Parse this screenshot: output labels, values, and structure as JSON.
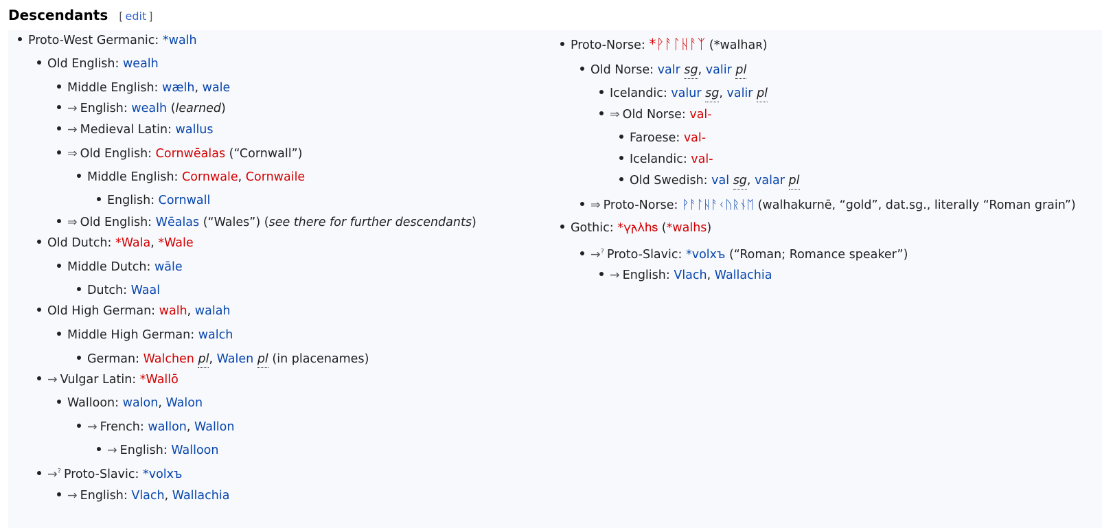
{
  "heading": {
    "title": "Descendants",
    "bracket_open": "[",
    "edit_label": "edit",
    "bracket_close": "]"
  },
  "colors": {
    "link": "#0645ad",
    "redlink": "#d20000",
    "box_background": "#f8f9fc",
    "text": "#202122"
  },
  "tree": {
    "pwg_lang": "Proto-West Germanic:",
    "pwg_w1": "*walh",
    "oe_lang": "Old English:",
    "oe_w1": "wealh",
    "me1_lang": "Middle English:",
    "me1_w1": "wælh",
    "me1_w2": "wale",
    "eng1_arrow": "→",
    "eng1_lang": "English:",
    "eng1_w1": "wealh",
    "eng1_note_open": "(",
    "eng1_note": "learned",
    "eng1_note_close": ")",
    "ml_arrow": "→",
    "ml_lang": "Medieval Latin:",
    "ml_w1": "wallus",
    "oe2_arrow": "⇒",
    "oe2_lang": "Old English:",
    "oe2_w1": "Cornwēalas",
    "oe2_gloss": "(“Cornwall”)",
    "me2_lang": "Middle English:",
    "me2_w1": "Cornwale",
    "me2_w2": "Cornwaile",
    "eng2_lang": "English:",
    "eng2_w1": "Cornwall",
    "oe3_arrow": "⇒",
    "oe3_lang": "Old English:",
    "oe3_w1": "Wēalas",
    "oe3_gloss": "(“Wales”) (",
    "oe3_note": "see there for further descendants",
    "oe3_note_close": ")",
    "od_lang": "Old Dutch:",
    "od_w1": "*Wala",
    "od_w2": "*Wale",
    "md_lang": "Middle Dutch:",
    "md_w1": "wāle",
    "du_lang": "Dutch:",
    "du_w1": "Waal",
    "ohg_lang": "Old High German:",
    "ohg_w1": "walh",
    "ohg_w2": "walah",
    "mhg_lang": "Middle High German:",
    "mhg_w1": "walch",
    "ger_lang": "German:",
    "ger_w1": "Walchen",
    "ger_g1": "pl",
    "ger_w2": "Walen",
    "ger_g2": "pl",
    "ger_note": "(in placenames)",
    "vl_arrow": "→",
    "vl_lang": "Vulgar Latin:",
    "vl_w1": "*Wallō",
    "wa_lang": "Walloon:",
    "wa_w1": "walon",
    "wa_w2": "Walon",
    "fr_arrow": "→",
    "fr_lang": "French:",
    "fr_w1": "wallon",
    "fr_w2": "Wallon",
    "eng3_arrow": "→",
    "eng3_lang": "English:",
    "eng3_w1": "Walloon",
    "ps1_arrow": "→",
    "ps1_sup": "?",
    "ps1_lang": "Proto-Slavic:",
    "ps1_w1": "*volxъ",
    "eng4_arrow": "→",
    "eng4_lang": "English:",
    "eng4_w1": "Vlach",
    "eng4_w2": "Wallachia",
    "pn_lang": "Proto-Norse:",
    "pn_w1": "*ᚹᚨᛚᚺᚨᛉ",
    "pn_translit": "(*walhaʀ)",
    "on_lang": "Old Norse:",
    "on_w1": "valr",
    "on_g1": "sg",
    "on_w2": "valir",
    "on_g2": "pl",
    "ic1_lang": "Icelandic:",
    "ic1_w1": "valur",
    "ic1_g1": "sg",
    "ic1_w2": "valir",
    "ic1_g2": "pl",
    "on2_arrow": "⇒",
    "on2_lang": "Old Norse:",
    "on2_w1": "val-",
    "fo_lang": "Faroese:",
    "fo_w1": "val-",
    "ic2_lang": "Icelandic:",
    "ic2_w1": "val-",
    "osw_lang": "Old Swedish:",
    "osw_w1": "val",
    "osw_g1": "sg",
    "osw_w2": "valar",
    "osw_g2": "pl",
    "pn2_arrow": "⇒",
    "pn2_lang": "Proto-Norse:",
    "pn2_w1": "ᚹᚨᛚᚺᚨᚲᚢᚱᚾᛖ",
    "pn2_gloss": "(walhakurnē, “gold”, dat.sg., literally “Roman grain”)",
    "go_lang": "Gothic:",
    "go_w1": "*𐍅𐌰𐌻𐌷𐍃",
    "go_paren_open": "(",
    "go_w2": "*walhs",
    "go_paren_close": ")",
    "ps2_arrow": "→",
    "ps2_sup": "?",
    "ps2_lang": "Proto-Slavic:",
    "ps2_w1": "*volxъ",
    "ps2_gloss": "(“Roman; Romance speaker”)",
    "eng5_arrow": "→",
    "eng5_lang": "English:",
    "eng5_w1": "Vlach",
    "eng5_w2": "Wallachia"
  }
}
